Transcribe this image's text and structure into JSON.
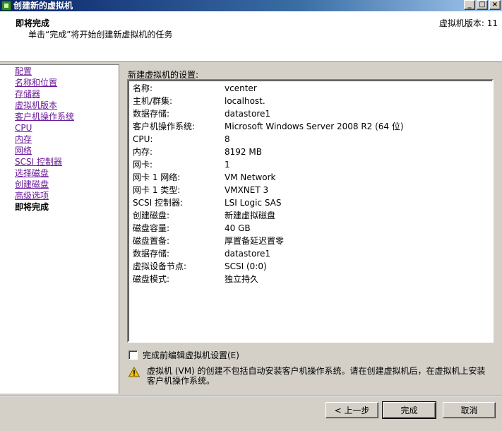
{
  "window": {
    "title": "创建新的虚拟机",
    "minimize": "_",
    "maximize": "□",
    "close": "×"
  },
  "header": {
    "title": "即将完成",
    "subtitle": "单击“完成”将开始创建新虚拟机的任务",
    "version": "虚拟机版本: 11"
  },
  "nav": {
    "items": [
      {
        "label": "配置"
      },
      {
        "label": "名称和位置"
      },
      {
        "label": "存储器"
      },
      {
        "label": "虚拟机版本"
      },
      {
        "label": "客户机操作系统"
      },
      {
        "label": "CPU"
      },
      {
        "label": "内存"
      },
      {
        "label": "网络"
      },
      {
        "label": "SCSI 控制器"
      },
      {
        "label": "选择磁盘"
      },
      {
        "label": "创建磁盘"
      },
      {
        "label": "高级选项"
      },
      {
        "label": "即将完成"
      }
    ]
  },
  "settings": {
    "label": "新建虚拟机的设置:",
    "rows": [
      {
        "key": "名称:",
        "value": "vcenter"
      },
      {
        "key": "主机/群集:",
        "value": "localhost."
      },
      {
        "key": "数据存储:",
        "value": "datastore1"
      },
      {
        "key": "客户机操作系统:",
        "value": "Microsoft Windows Server 2008 R2 (64 位)"
      },
      {
        "key": "CPU:",
        "value": "8"
      },
      {
        "key": "内存:",
        "value": "8192 MB"
      },
      {
        "key": "网卡:",
        "value": "1"
      },
      {
        "key": "网卡 1 网络:",
        "value": "VM Network"
      },
      {
        "key": "网卡 1 类型:",
        "value": "VMXNET 3"
      },
      {
        "key": "SCSI 控制器:",
        "value": "LSI Logic SAS"
      },
      {
        "key": "创建磁盘:",
        "value": "新建虚拟磁盘"
      },
      {
        "key": "磁盘容量:",
        "value": "40 GB"
      },
      {
        "key": "磁盘置备:",
        "value": "厚置备延迟置零"
      },
      {
        "key": "数据存储:",
        "value": "datastore1"
      },
      {
        "key": "虚拟设备节点:",
        "value": "SCSI (0:0)"
      },
      {
        "key": "磁盘模式:",
        "value": "独立持久"
      }
    ]
  },
  "checkbox": {
    "label": "完成前编辑虚拟机设置(E)",
    "checked": false
  },
  "warning": {
    "text": "虚拟机 (VM) 的创建不包括自动安装客户机操作系统。请在创建虚拟机后，在虚拟机上安装客户机操作系统。"
  },
  "buttons": {
    "back": "< 上一步",
    "finish": "完成",
    "cancel": "取消"
  },
  "colors": {
    "link": "#6a1b9a",
    "titlebar": "#0a246a",
    "warning": "#f2c200"
  }
}
